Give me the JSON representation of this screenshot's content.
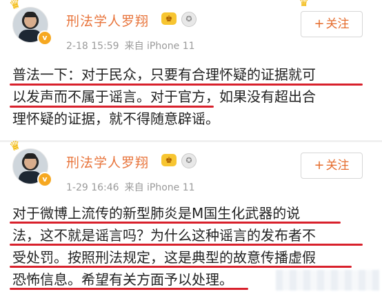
{
  "posts": [
    {
      "username": "刑法学人罗翔",
      "date": "2-18 15:59",
      "source": "来自 iPhone 11",
      "follow_label": "关注",
      "follow_plus": "+",
      "lines": [
        "普法一下：对于民众，只要有合理怀疑的证据就可",
        "以发声而不属于谣言。对于官方，如果没有超出合",
        "理怀疑的证据，就不得随意辟谣。"
      ]
    },
    {
      "username": "刑法学人罗翔",
      "date": "1-29 16:46",
      "source": "来自 iPhone 11",
      "follow_label": "关注",
      "follow_plus": "+",
      "lines": [
        "对于微博上流传的新型肺炎是M国生化武器的说",
        "法，这不就是谣言吗？为什么这种谣言的发布者不",
        "受处罚。按照刑法规定，这是典型的故意传播虚假",
        "恐怖信息。希望有关方面予以处理。"
      ]
    }
  ],
  "icons": {
    "vip": "vip-crown-badge",
    "medal": "medal-badge",
    "verified": "verified-v-badge",
    "crown": "crown-decoration"
  },
  "colors": {
    "username": "#e8743b",
    "underline": "#d8202b",
    "follow_text": "#e56b2b"
  }
}
